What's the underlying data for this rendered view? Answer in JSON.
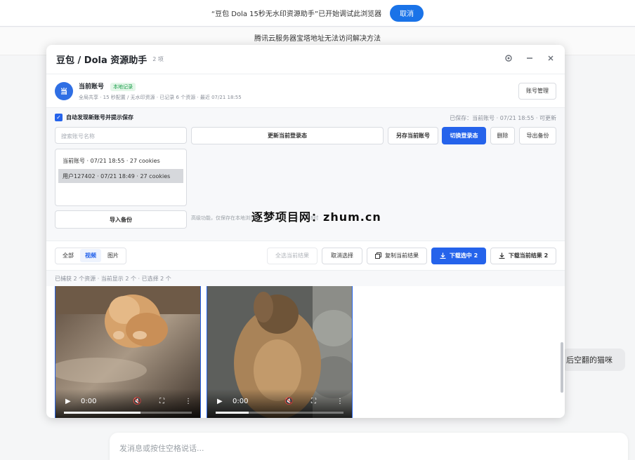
{
  "debug_bar": {
    "text": "“豆包 Dola 15秒无水印资源助手”已开始调试此浏览器",
    "cancel": "取消"
  },
  "background": {
    "title": "腾讯云服务器宝塔地址无法访问解决方法",
    "side_bubble": "后空翻的猫咪",
    "input_placeholder": "发消息或按住空格说话..."
  },
  "panel": {
    "title": "豆包 / Dola 资源助手",
    "count": "2 项",
    "icons": [
      "gear-icon",
      "minimize-icon",
      "close-icon"
    ]
  },
  "account": {
    "avatar": "当",
    "name": "当前账号",
    "badge": "本地记录",
    "meta": "全局共享 · 15 秒配置 / 无水印资源 · 已记录 6 个资源 · 最近 07/21 18:55",
    "manage_button": "账号管理"
  },
  "manager": {
    "auto_detect_label": "自动发现新账号并提示保存",
    "saved_status": "已保存：当前账号 · 07/21 18:55 · 可更新",
    "search_placeholder": "搜索账号名称",
    "update_button": "更新当前登录态",
    "save_as_button": "另存当前账号",
    "switch_button": "切换登录态",
    "delete_button": "删除",
    "export_button": "导出备份",
    "accounts": [
      {
        "label": "当前账号 · 07/21 18:55 · 27 cookies"
      },
      {
        "label": "用户127402 · 07/21 18:49 · 27 cookies"
      }
    ],
    "import_button": "导入备份",
    "hint": "高级功能，仅保存在本地浏览器 · 请勿泄露 · 登录态可随时"
  },
  "filter": {
    "tabs": [
      "全部",
      "视频",
      "图片"
    ],
    "select_all": "全选当前结果",
    "deselect": "取消选择",
    "copy": "复制当前结果",
    "download_selected": "下载选中 2",
    "download_results": "下载当前结果 2"
  },
  "status": "已捕获 2 个资源 · 当前显示 2 个 · 已选择 2 个",
  "videos": [
    {
      "time": "0:00",
      "progress": 0.6,
      "subject": "cat"
    },
    {
      "time": "0:00",
      "progress": 0.26,
      "subject": "monkey"
    }
  ],
  "watermark": "逐梦项目网：zhum.cn"
}
